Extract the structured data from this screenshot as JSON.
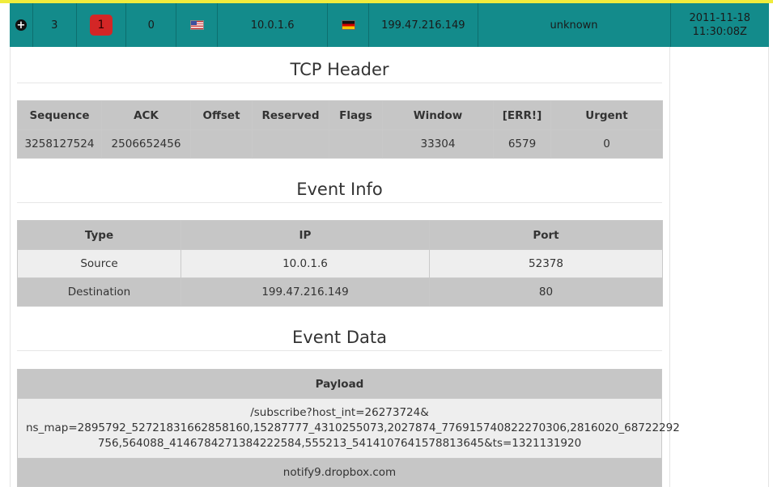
{
  "event_row": {
    "expand_icon": "plus-circle-icon",
    "id": "3",
    "priority": "1",
    "count": "0",
    "src_flag": "us-flag-icon",
    "src_ip": "10.0.1.6",
    "dst_flag": "de-flag-icon",
    "dst_ip": "199.47.216.149",
    "signature": "unknown",
    "timestamp_date": "2011-11-18",
    "timestamp_time": "11:30:08Z",
    "colors": {
      "row_bg": "#138b8b",
      "priority_bg": "#d32626",
      "top_border": "#f0ec3c"
    }
  },
  "tcp_header": {
    "title": "TCP Header",
    "columns": [
      "Sequence",
      "ACK",
      "Offset",
      "Reserved",
      "Flags",
      "Window",
      "[ERR!]",
      "Urgent"
    ],
    "values": [
      "3258127524",
      "2506652456",
      "",
      "",
      "",
      "33304",
      "6579",
      "0"
    ]
  },
  "event_info": {
    "title": "Event Info",
    "columns": [
      "Type",
      "IP",
      "Port"
    ],
    "rows": [
      [
        "Source",
        "10.0.1.6",
        "52378"
      ],
      [
        "Destination",
        "199.47.216.149",
        "80"
      ]
    ]
  },
  "event_data": {
    "title": "Event Data",
    "column": "Payload",
    "payload_line1": "/subscribe?host_int=26273724&",
    "payload_line2": "ns_map=2895792_52721831662858160,15287777_4310255073,2027874_776915740822270306,2816020_68722292",
    "payload_line3": "756,564088_414678427138422258­4,555213_5414107641578813645&ts=1321131920",
    "host": "notify9.dropbox.com"
  }
}
